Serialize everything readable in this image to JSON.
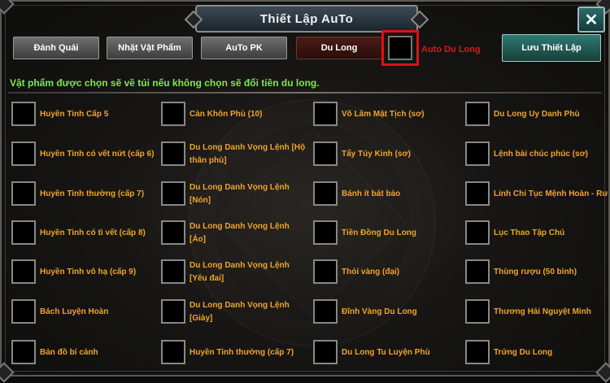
{
  "window": {
    "title": "Thiết Lập AuTo",
    "close_label": "✕"
  },
  "tabs": [
    {
      "label": "Đánh Quái"
    },
    {
      "label": "Nhặt Vật Phẩm"
    },
    {
      "label": "AuTo PK"
    },
    {
      "label": "Du Long"
    }
  ],
  "auto_du_long": {
    "label": "Auto Du Long"
  },
  "save_button": {
    "label": "Lưu Thiết Lập"
  },
  "notice": "Vật phẩm được chọn sẽ về túi nếu không chọn sẽ đổi tiền du long.",
  "items": [
    [
      "Huyền Tinh Cấp 5",
      "Càn Khôn Phù (10)",
      "Võ Lâm Mật Tịch (sơ)",
      "Du Long Uy Danh Phù"
    ],
    [
      "Huyền Tinh có vết nứt (cấp 6)",
      "Du Long Danh Vọng Lệnh [Hộ thân phù]",
      "Tẩy Tủy Kinh (sơ)",
      "Lệnh bài chúc phúc (sơ)"
    ],
    [
      "Huyền Tinh thường (cấp 7)",
      "Du Long Danh Vọng Lệnh [Nón]",
      "Bánh ít bát bảo",
      "Linh Chi Tục Mệnh Hoàn - Rương"
    ],
    [
      "Huyền Tinh có tì vết (cấp 8)",
      "Du Long Danh Vọng Lệnh [Áo]",
      "Tiền Đồng Du Long",
      "Lục Thao Tập Chú"
    ],
    [
      "Huyền Tinh vô hạ (cấp 9)",
      "Du Long Danh Vọng Lệnh [Yêu đai]",
      "Thỏi vàng (đại)",
      "Thùng rượu (50 bình)"
    ],
    [
      "Bách Luyện Hoàn",
      "Du Long Danh Vọng Lệnh [Giày]",
      "Đĩnh Vàng Du Long",
      "Thương Hải Nguyệt Minh"
    ],
    [
      "Bản đồ bí cảnh",
      "Huyền Tinh thường (cấp 7)",
      "Du Long Tu Luyện Phù",
      "Trứng Du Long"
    ]
  ]
}
